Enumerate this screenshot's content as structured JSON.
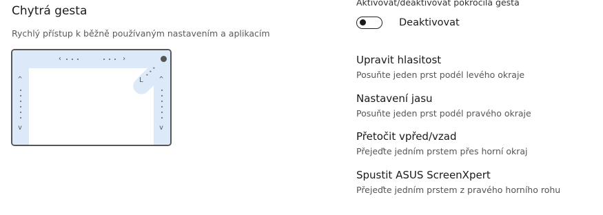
{
  "header": {
    "title": "Chytrá gesta",
    "subtitle": "Rychlý přístup k běžně používaným nastavením a aplikacím"
  },
  "preview": {
    "top_left_arrow": "‹",
    "top_right_arrow": "›",
    "up_arrow": "^",
    "down_arrow": "v",
    "diag_arrow": "L"
  },
  "activation": {
    "label": "Aktivovat/deaktivovat pokročilá gesta",
    "toggle_state": "off",
    "toggle_text": "Deaktivovat"
  },
  "gestures": [
    {
      "title": "Upravit hlasitost",
      "description": "Posuňte jeden prst podél levého okraje"
    },
    {
      "title": "Nastavení jasu",
      "description": "Posuňte jeden prst podél pravého okraje"
    },
    {
      "title": "Přetočit vpřed/vzad",
      "description": "Přejeďte jedním prstem přes horní okraj"
    },
    {
      "title": "Spustit ASUS ScreenXpert",
      "description": "Přejeďte jedním prstem z pravého horního rohu"
    }
  ],
  "colors": {
    "zone_highlight": "#dce9f9",
    "border": "#555555"
  }
}
